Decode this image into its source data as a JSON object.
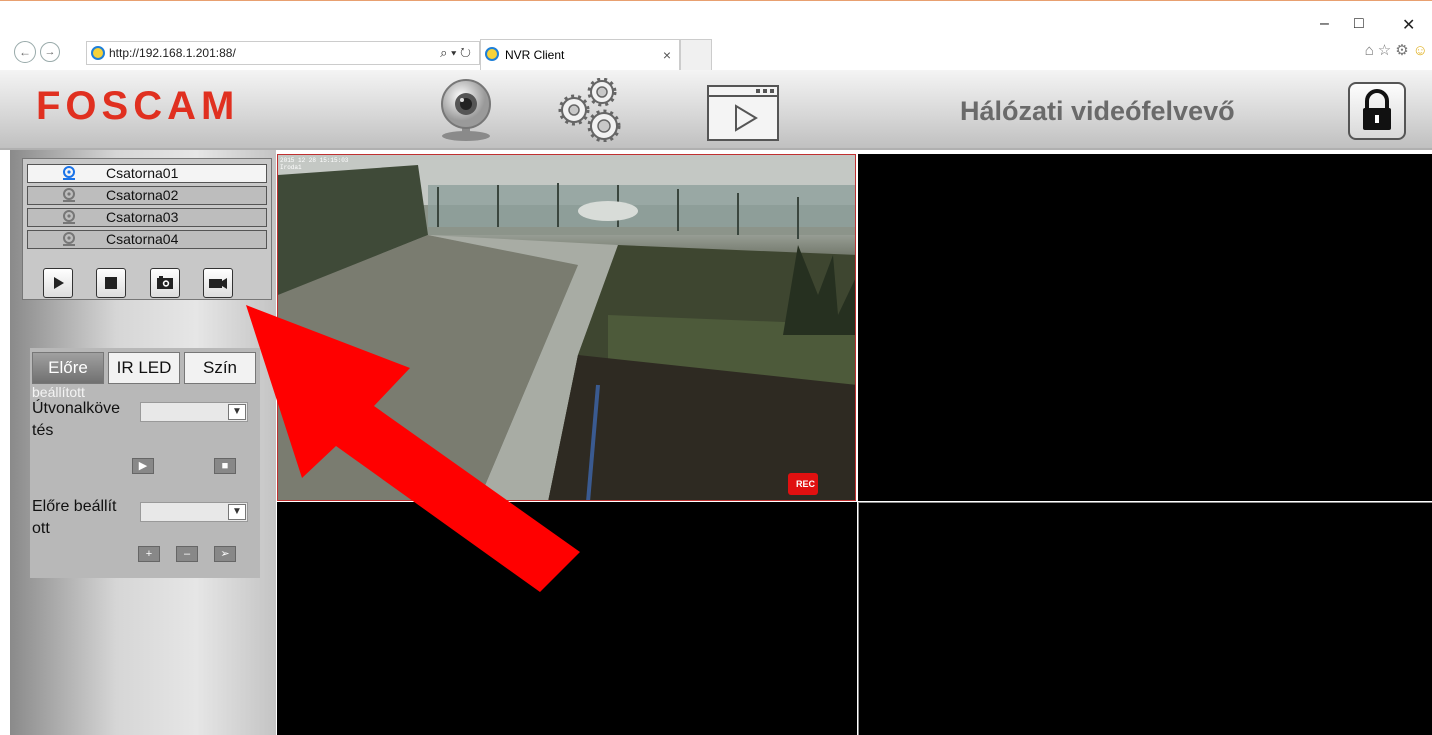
{
  "browser": {
    "url": "http://192.168.1.201:88/",
    "search_glyph": "⌕ ▾ ↻",
    "tab_title": "NVR Client",
    "tab_close": "×",
    "back_glyph": "←",
    "forward_glyph": "→",
    "minimize": "–",
    "maximize": "□",
    "close": "✕",
    "toolbar_icons": [
      "home-icon",
      "star-icon",
      "gear-icon",
      "smiley-icon"
    ]
  },
  "header": {
    "logo": "FOSCAM",
    "title": "Hálózati videófelvevő",
    "icons": [
      "webcam-icon",
      "settings-gears-icon",
      "playback-icon",
      "lock-icon"
    ]
  },
  "channels": [
    {
      "label": "Csatorna01",
      "active": true
    },
    {
      "label": "Csatorna02",
      "active": false
    },
    {
      "label": "Csatorna03",
      "active": false
    },
    {
      "label": "Csatorna04",
      "active": false
    }
  ],
  "channel_controls": [
    "play-icon",
    "stop-icon",
    "snapshot-icon",
    "record-icon"
  ],
  "ptz": {
    "tabs": [
      "Előre",
      "IR LED",
      "Szín"
    ],
    "tab_sub": "beállított",
    "cruise_label_1": "Útvonalköve",
    "cruise_label_2": "tés",
    "preset_label_1": "Előre beállít",
    "preset_label_2": "ott",
    "cruise_value": "",
    "preset_value": ""
  },
  "video": {
    "cam1_timestamp": "2015 12 28 15:15:03",
    "cam1_name": "Iroda1",
    "rec_label": "REC"
  },
  "colors": {
    "logo": "#e03020",
    "arrow": "#ff0000",
    "rec": "#e01010",
    "active_tile_border": "#c03030"
  }
}
